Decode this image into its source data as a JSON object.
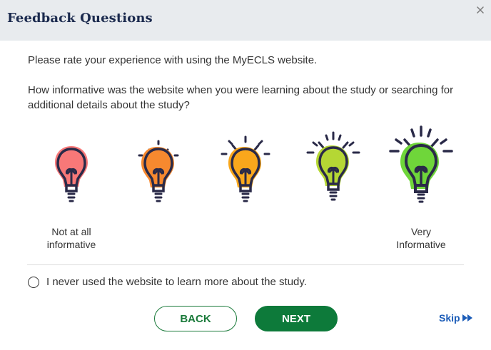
{
  "dialog": {
    "title": "Feedback Questions",
    "close_icon": "close-icon"
  },
  "question": {
    "intro": "Please rate your experience with using the MyECLS website.",
    "prompt": "How informative was the website when you were learning about the study or searching for additional details about the study?"
  },
  "rating": {
    "options": [
      {
        "name": "rating-1",
        "icon": "lightbulb-icon",
        "color": "#f87878"
      },
      {
        "name": "rating-2",
        "icon": "lightbulb-icon",
        "color": "#f7892f"
      },
      {
        "name": "rating-3",
        "icon": "lightbulb-icon",
        "color": "#f9a71c"
      },
      {
        "name": "rating-4",
        "icon": "lightbulb-icon",
        "color": "#b5d734"
      },
      {
        "name": "rating-5",
        "icon": "lightbulb-icon",
        "color": "#6fd63a"
      }
    ],
    "low_label": "Not at all informative",
    "high_label": "Very Informative"
  },
  "never_option": {
    "label": "I never used the website to learn more about the study."
  },
  "buttons": {
    "back": "BACK",
    "next": "NEXT",
    "skip": "Skip"
  },
  "colors": {
    "header_bg": "#e8ebee",
    "title": "#1b2a4e",
    "primary_green": "#0d7a3a",
    "link_blue": "#1b5cb8"
  }
}
